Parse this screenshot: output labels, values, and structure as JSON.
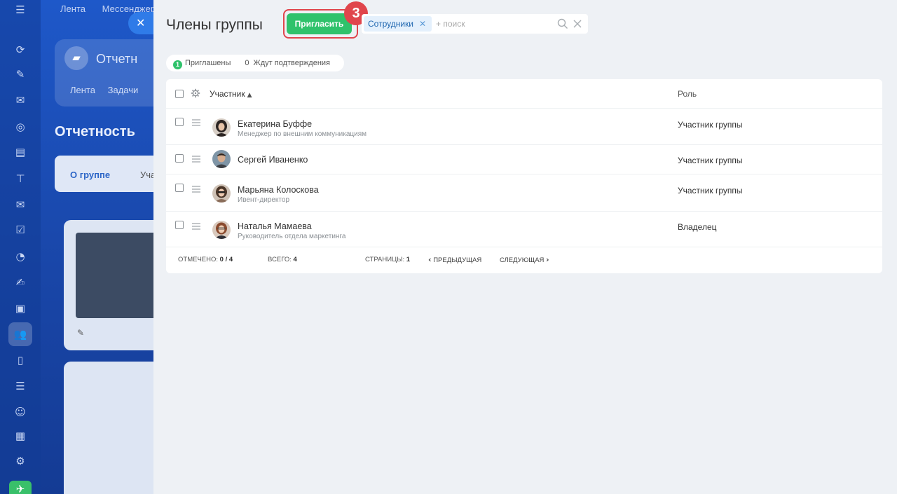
{
  "background": {
    "topnav": [
      "Лента",
      "Мессенджер"
    ],
    "card_title": "Отчетн",
    "card_tabs": [
      "Лента",
      "Задачи"
    ],
    "page_title": "Отчетность",
    "tabs": [
      "О группе",
      "Уча"
    ]
  },
  "panel": {
    "title": "Члены группы",
    "invite_label": "Пригласить",
    "step_number": "3",
    "filter": {
      "chip_label": "Сотрудники",
      "search_placeholder": "+ поиск"
    },
    "counters": {
      "invited_count": "1",
      "invited_label": "Приглашены",
      "pending_count": "0",
      "pending_label": "Ждут подтверждения"
    }
  },
  "grid": {
    "columns": {
      "name": "Участник",
      "role": "Роль"
    },
    "rows": [
      {
        "name": "Екатерина Буффе",
        "position": "Менеджер по внешним коммуникациям",
        "role": "Участник группы"
      },
      {
        "name": "Сергей Иваненко",
        "position": "",
        "role": "Участник группы"
      },
      {
        "name": "Марьяна Колоскова",
        "position": "Ивент-директор",
        "role": "Участник группы"
      },
      {
        "name": "Наталья Мамаева",
        "position": "Руководитель отдела маркетинга",
        "role": "Владелец"
      }
    ],
    "footer": {
      "selected_label": "ОТМЕЧЕНО:",
      "selected_value": "0 / 4",
      "total_label": "ВСЕГО:",
      "total_value": "4",
      "pages_label": "СТРАНИЦЫ:",
      "pages_value": "1",
      "prev_label": "ПРЕДЫДУЩАЯ",
      "next_label": "СЛЕДУЮЩАЯ"
    }
  },
  "colors": {
    "accent_green": "#2fc26b",
    "highlight_red": "#e0454c",
    "link_blue": "#2067b0"
  }
}
